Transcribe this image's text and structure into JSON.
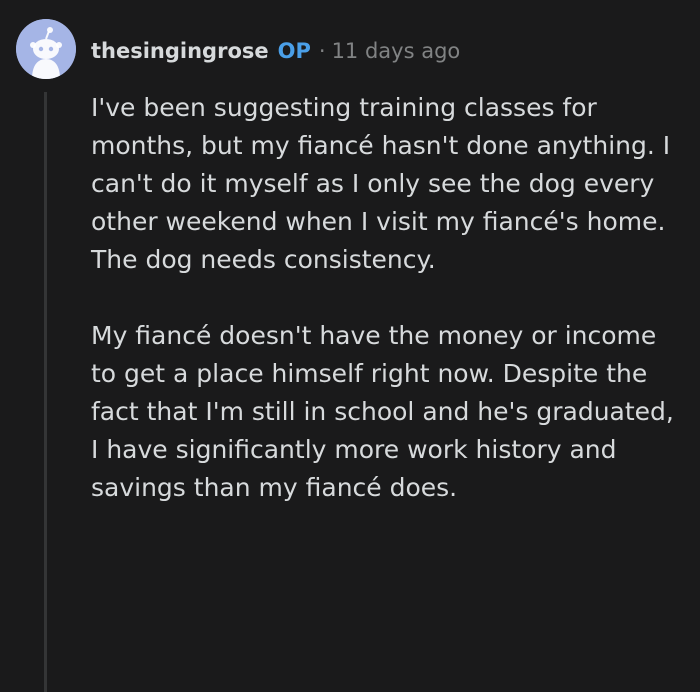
{
  "comment": {
    "username": "thesingingrose",
    "op_badge": "OP",
    "separator": "·",
    "timestamp": "11 days ago",
    "avatar_icon": "reddit-snoo-avatar-icon",
    "paragraphs": [
      "I've been suggesting training classes for months, but my fiancé hasn't done anything. I can't do it myself as I only see the dog every other weekend when I visit my fiancé's home. The dog needs consistency.",
      "My fiancé doesn't have the money or income to get a place himself right now. Despite the fact that I'm still in school and he's graduated, I have significantly more work history and savings than my fiancé does."
    ]
  },
  "colors": {
    "background": "#1a1a1b",
    "text": "#d7dadc",
    "muted": "#818384",
    "op_badge": "#4a9fe8",
    "avatar_bg": "#a5b5e6",
    "thread_line": "#343536"
  }
}
